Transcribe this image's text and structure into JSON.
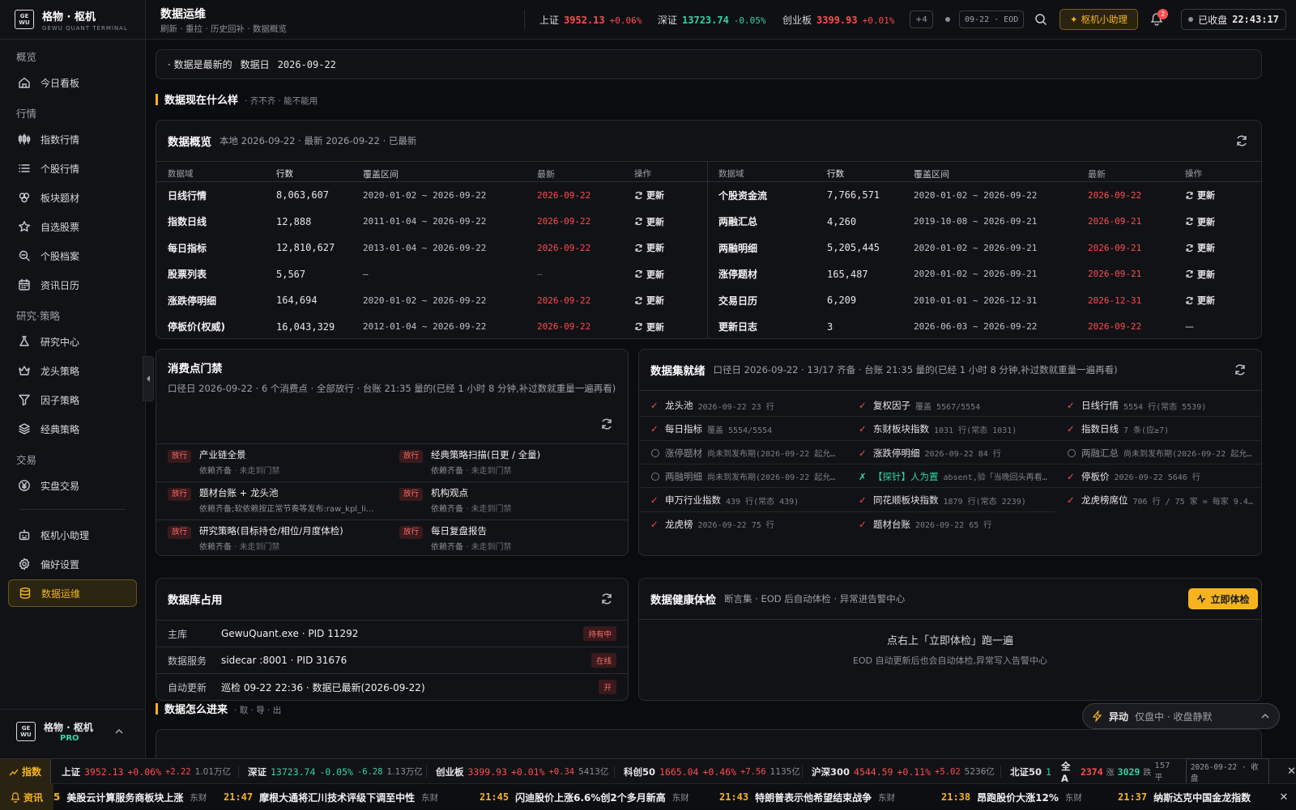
{
  "app": {
    "name": "格物 · 枢机",
    "sub": "GEWU QUANT TERMINAL",
    "logo_text": "GE WU"
  },
  "sidebar": {
    "sections": [
      {
        "label": "概览",
        "items": [
          {
            "label": "今日看板",
            "icon": "home-icon"
          }
        ]
      },
      {
        "label": "行情",
        "items": [
          {
            "label": "指数行情",
            "icon": "candles-icon"
          },
          {
            "label": "个股行情",
            "icon": "list-icon"
          },
          {
            "label": "板块题材",
            "icon": "blocks-icon"
          },
          {
            "label": "自选股票",
            "icon": "star-icon"
          },
          {
            "label": "个股档案",
            "icon": "search-doc-icon"
          },
          {
            "label": "资讯日历",
            "icon": "calendar-icon"
          }
        ]
      },
      {
        "label": "研究·策略",
        "items": [
          {
            "label": "研究中心",
            "icon": "flask-icon"
          },
          {
            "label": "龙头策略",
            "icon": "crown-icon"
          },
          {
            "label": "因子策略",
            "icon": "filter-icon"
          },
          {
            "label": "经典策略",
            "icon": "layers-icon"
          }
        ]
      },
      {
        "label": "交易",
        "items": [
          {
            "label": "实盘交易",
            "icon": "yen-icon"
          }
        ]
      }
    ],
    "bottom_items": [
      {
        "label": "枢机小助理",
        "icon": "robot-icon"
      },
      {
        "label": "偏好设置",
        "icon": "gear-icon"
      },
      {
        "label": "数据运维",
        "icon": "database-icon",
        "active": true
      }
    ],
    "footer": {
      "name": "格物 · 枢机",
      "tier": "PRO"
    }
  },
  "topbar": {
    "title": "数据运维",
    "subtitle": "刷新 · 重拉 · 历史回补 · 数据概览",
    "indices": [
      {
        "name": "上证",
        "value": "3952.13",
        "change": "+0.06%",
        "dir": "up"
      },
      {
        "name": "深证",
        "value": "13723.74",
        "change": "-0.05%",
        "dir": "down"
      },
      {
        "name": "创业板",
        "value": "3399.93",
        "change": "+0.01%",
        "dir": "up"
      }
    ],
    "more": "+4",
    "date_chip": "09-22 · EOD",
    "helper": "枢机小助理",
    "notif_count": "2",
    "market_status": "已收盘",
    "time": "22:43:17"
  },
  "banner": {
    "status": "· 数据是最新的",
    "label": "数据日",
    "date": "2026-09-22"
  },
  "section1": {
    "title": "数据现在什么样",
    "sub": "· 齐不齐 · 能不能用"
  },
  "overview": {
    "title": "数据概览",
    "sub": "本地 2026-09-22 · 最新 2026-09-22 · 已最新",
    "headers": [
      "数据域",
      "行数",
      "覆盖区间",
      "最新",
      "操作"
    ],
    "action": "更新",
    "left": [
      {
        "name": "日线行情",
        "rows": "8,063,607",
        "range": "2020-01-02 ~ 2026-09-22",
        "latest": "2026-09-22"
      },
      {
        "name": "指数日线",
        "rows": "12,888",
        "range": "2011-01-04 ~ 2026-09-22",
        "latest": "2026-09-22"
      },
      {
        "name": "每日指标",
        "rows": "12,810,627",
        "range": "2013-01-04 ~ 2026-09-22",
        "latest": "2026-09-22"
      },
      {
        "name": "股票列表",
        "rows": "5,567",
        "range": "—",
        "latest": "—"
      },
      {
        "name": "涨跌停明细",
        "rows": "164,694",
        "range": "2020-01-02 ~ 2026-09-22",
        "latest": "2026-09-22"
      },
      {
        "name": "停板价(权威)",
        "rows": "16,043,329",
        "range": "2012-01-04 ~ 2026-09-22",
        "latest": "2026-09-22"
      }
    ],
    "right": [
      {
        "name": "个股资金流",
        "rows": "7,766,571",
        "range": "2020-01-02 ~ 2026-09-22",
        "latest": "2026-09-22"
      },
      {
        "name": "两融汇总",
        "rows": "4,260",
        "range": "2019-10-08 ~ 2026-09-21",
        "latest": "2026-09-21"
      },
      {
        "name": "两融明细",
        "rows": "5,205,445",
        "range": "2020-01-02 ~ 2026-09-21",
        "latest": "2026-09-21"
      },
      {
        "name": "涨停题材",
        "rows": "165,487",
        "range": "2020-01-02 ~ 2026-09-21",
        "latest": "2026-09-21"
      },
      {
        "name": "交易日历",
        "rows": "6,209",
        "range": "2010-01-01 ~ 2026-12-31",
        "latest": "2026-12-31"
      },
      {
        "name": "更新日志",
        "rows": "3",
        "range": "2026-06-03 ~ 2026-09-22",
        "latest": "2026-09-22",
        "no_action": true
      }
    ]
  },
  "gates": {
    "title": "消费点门禁",
    "sub": "口径日 2026-09-22 · 6 个消费点 · 全部放行 · 台账 21:35 量的(已经 1 小时 8 分钟,补过数就重量一遍再看)",
    "tag": "放行",
    "items": [
      {
        "name": "产业链全景",
        "dep": "依赖齐备",
        "note": "未走到门禁"
      },
      {
        "name": "经典策略扫描(日更 / 全量)",
        "dep": "依赖齐备",
        "note": "未走到门禁"
      },
      {
        "name": "题材台账 + 龙头池",
        "dep": "依赖齐备;软依赖按正常节奏等发布:raw_kpl_li…",
        "note": ""
      },
      {
        "name": "机构观点",
        "dep": "依赖齐备",
        "note": "未走到门禁"
      },
      {
        "name": "研究策略(目标持仓/相位/月度体检)",
        "dep": "依赖齐备",
        "note": "未走到门禁"
      },
      {
        "name": "每日复盘报告",
        "dep": "依赖齐备",
        "note": "未走到门禁"
      }
    ]
  },
  "datasets": {
    "title": "数据集就绪",
    "sub": "口径日 2026-09-22 · 13/17 齐备 · 台账 21:35 量的(已经 1 小时 8 分钟,补过数就重量一遍再看)",
    "items": [
      {
        "status": "ok",
        "name": "龙头池",
        "detail": "2026-09-22 23 行"
      },
      {
        "status": "ok",
        "name": "复权因子",
        "detail": "覆盖 5567/5554"
      },
      {
        "status": "ok",
        "name": "日线行情",
        "detail": "5554 行(常态 5539)"
      },
      {
        "status": "ok",
        "name": "每日指标",
        "detail": "覆盖 5554/5554"
      },
      {
        "status": "ok",
        "name": "东财板块指数",
        "detail": "1031 行(常态 1031)"
      },
      {
        "status": "ok",
        "name": "指数日线",
        "detail": "7 条(应≥7)"
      },
      {
        "status": "pending",
        "name": "涨停题材",
        "detail": "尚未到发布期(2026-09-22 起允…"
      },
      {
        "status": "ok",
        "name": "涨跌停明细",
        "detail": "2026-09-22 84 行"
      },
      {
        "status": "pending",
        "name": "两融汇总",
        "detail": "尚未到发布期(2026-09-22 起允…"
      },
      {
        "status": "pending",
        "name": "两融明细",
        "detail": "尚未到发布期(2026-09-22 起允…"
      },
      {
        "status": "fail",
        "name": "【探针】人为置",
        "detail": "absent,验「当晚回头再看…"
      },
      {
        "status": "ok",
        "name": "停板价",
        "detail": "2026-09-22 5646 行"
      },
      {
        "status": "ok",
        "name": "申万行业指数",
        "detail": "439 行(常态 439)"
      },
      {
        "status": "ok",
        "name": "同花顺板块指数",
        "detail": "1879 行(常态 2239)"
      },
      {
        "status": "ok",
        "name": "龙虎榜席位",
        "detail": "706 行 / 75 家 = 每家 9.4…"
      },
      {
        "status": "ok",
        "name": "龙虎榜",
        "detail": "2026-09-22 75 行"
      },
      {
        "status": "ok",
        "name": "题材台账",
        "detail": "2026-09-22 65 行"
      }
    ]
  },
  "db": {
    "title": "数据库占用",
    "rows": [
      {
        "k": "主库",
        "v": "GewuQuant.exe · PID 11292",
        "badge": "持有中"
      },
      {
        "k": "数据服务",
        "v": "sidecar :8001 · PID 31676",
        "badge": "在线"
      },
      {
        "k": "自动更新",
        "v": "巡检 09-22 22:36 · 数据已最新(2026-09-22)",
        "badge": "开"
      }
    ]
  },
  "health": {
    "title": "数据健康体检",
    "sub": "断言集 · EOD 后自动体检 · 异常进告警中心",
    "button": "立即体检",
    "empty_title": "点右上「立即体检」跑一遍",
    "empty_sub": "EOD 自动更新后也会自动体检,异常写入告警中心"
  },
  "section2": {
    "title": "数据怎么进来",
    "sub": "· 取 · 导 · 出"
  },
  "anomaly": {
    "label": "异动",
    "text": "仅盘中 · 收盘静默"
  },
  "ticker": {
    "label": "指数",
    "items": [
      {
        "name": "上证",
        "value": "3952.13",
        "pct": "+0.06%",
        "chg": "+2.22",
        "amt": "1.01万亿",
        "dir": "up"
      },
      {
        "name": "深证",
        "value": "13723.74",
        "pct": "-0.05%",
        "chg": "-6.28",
        "amt": "1.13万亿",
        "dir": "down"
      },
      {
        "name": "创业板",
        "value": "3399.93",
        "pct": "+0.01%",
        "chg": "+0.34",
        "amt": "5413亿",
        "dir": "up"
      },
      {
        "name": "科创50",
        "value": "1665.04",
        "pct": "+0.46%",
        "chg": "+7.56",
        "amt": "1135亿",
        "dir": "up"
      },
      {
        "name": "沪深300",
        "value": "4544.59",
        "pct": "+0.11%",
        "chg": "+5.02",
        "amt": "5236亿",
        "dir": "up"
      },
      {
        "name": "北证50",
        "value": "1",
        "pct": "",
        "chg": "",
        "amt": "",
        "dir": "down"
      }
    ],
    "breadth": {
      "label": "全A",
      "up": "2374",
      "up_label": "涨",
      "down": "3029",
      "down_label": "跌",
      "flat": "157平"
    },
    "date": "2026-09-22 · 收盘"
  },
  "news": {
    "label": "资讯",
    "items": [
      {
        "time": "",
        "headline": "美股云计算服务商板块上涨",
        "src": "东财"
      },
      {
        "time": "21:47",
        "headline": "摩根大通将汇川技术评级下调至中性",
        "src": "东财"
      },
      {
        "time": "21:45",
        "headline": "闪迪股价上涨6.6%创2个多月新高",
        "src": "东财"
      },
      {
        "time": "21:43",
        "headline": "特朗普表示他希望结束战争",
        "src": "东财"
      },
      {
        "time": "21:38",
        "headline": "昂跑股价大涨12%",
        "src": "东财"
      },
      {
        "time": "21:37",
        "headline": "纳斯达克中国金龙指数",
        "src": ""
      }
    ]
  },
  "colors": {
    "accent": "#f5b41f",
    "up": "#ff4d4f",
    "down": "#2fd6a0",
    "bg": "#0b0c0f",
    "panel": "#111216"
  }
}
